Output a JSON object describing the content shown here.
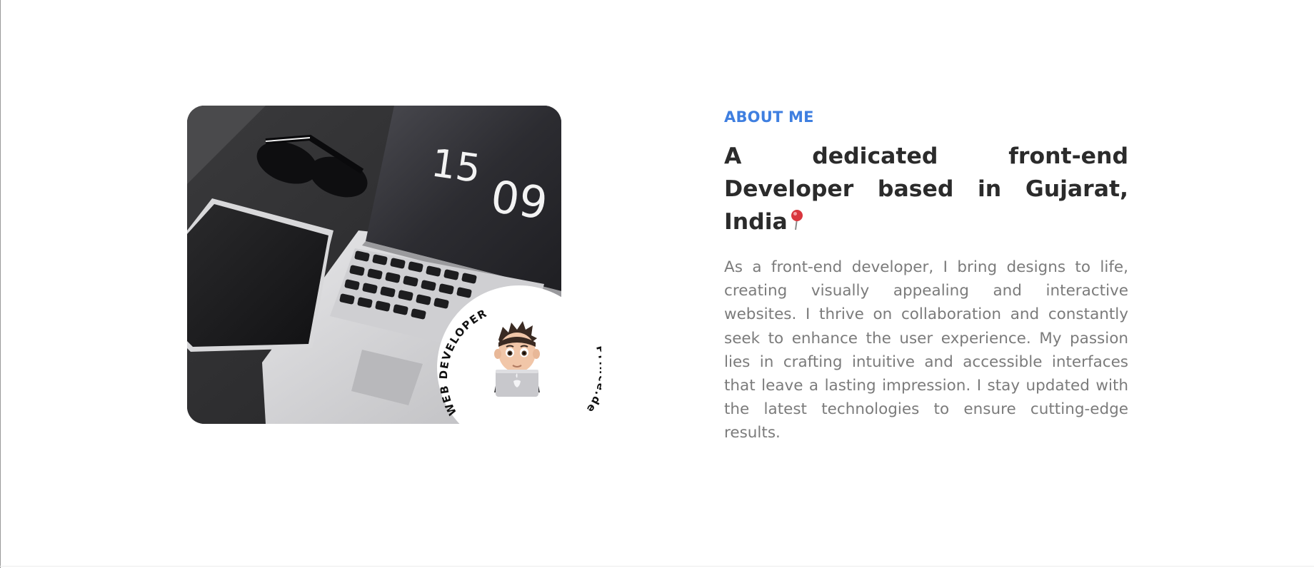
{
  "photo": {
    "clock_hour": "15",
    "clock_minute": "09"
  },
  "badge": {
    "left_text": "WEB DEVELOPER",
    "right_text": "Prince.dev"
  },
  "about": {
    "eyebrow": "ABOUT ME",
    "headline": "A dedicated front-end Developer based in Gujarat, India",
    "headline_icon": "round-pushpin-icon",
    "body": "As a front-end developer, I bring designs to life, creating visually appealing and interactive websites. I thrive on collaboration and constantly seek to enhance the user experience. My passion lies in crafting intuitive and accessible interfaces that leave a lasting impression. I stay updated with the latest technologies to ensure cutting-edge results."
  },
  "colors": {
    "accent": "#3f7fe0",
    "heading": "#2b2b2b",
    "body": "#7b7b7b",
    "pin": "#d9363e"
  }
}
